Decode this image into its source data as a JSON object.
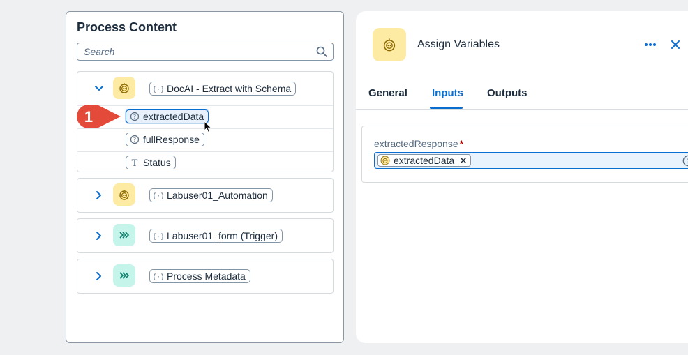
{
  "left_panel": {
    "title": "Process Content",
    "search": {
      "placeholder": "Search",
      "value": ""
    },
    "nodes": [
      {
        "label": "DocAI - Extract with Schema",
        "icon": "bot-icon",
        "expanded": true,
        "children": [
          {
            "label": "extractedData",
            "type_icon": "unknown-type-icon",
            "selected": true
          },
          {
            "label": "fullResponse",
            "type_icon": "unknown-type-icon",
            "selected": false
          },
          {
            "label": "Status",
            "type_icon": "text-type-icon",
            "selected": false
          }
        ]
      },
      {
        "label": "Labuser01_Automation",
        "icon": "bot-icon",
        "expanded": false
      },
      {
        "label": "Labuser01_form (Trigger)",
        "icon": "trigger-icon",
        "expanded": false
      },
      {
        "label": "Process Metadata",
        "icon": "trigger-icon",
        "expanded": false
      }
    ]
  },
  "callout": {
    "number": "1",
    "color": "#e44a3a"
  },
  "right_panel": {
    "title": "Assign Variables",
    "tabs": [
      "General",
      "Inputs",
      "Outputs"
    ],
    "active_tab": "Inputs",
    "field": {
      "label": "extractedResponse",
      "required_marker": "*",
      "token": "extractedData"
    }
  },
  "colors": {
    "accent": "#0a6ed1",
    "bot_icon_bg": "#fdeaa3",
    "trigger_icon_bg": "#c4f4ea",
    "required": "#bb0000"
  }
}
